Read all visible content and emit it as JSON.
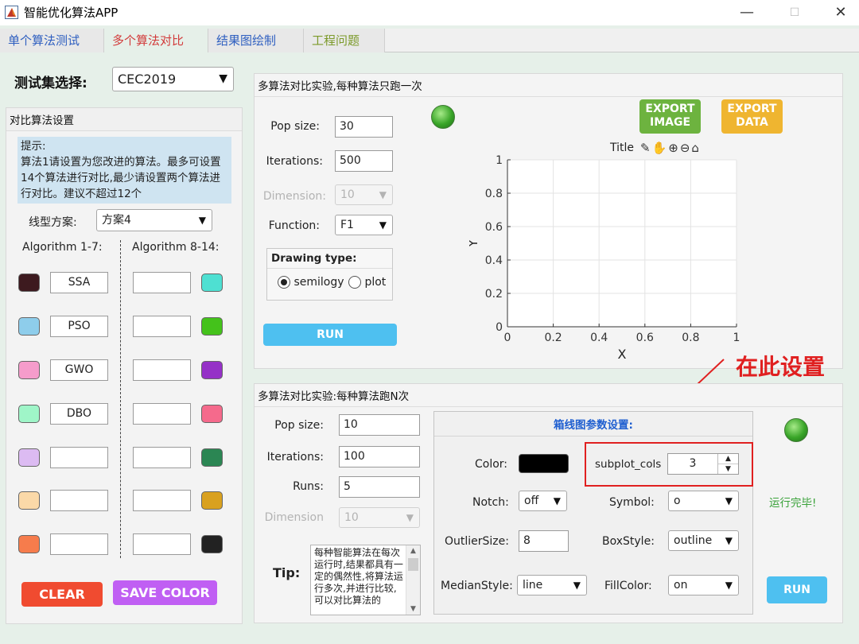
{
  "window": {
    "title": "智能优化算法APP",
    "minimize": "—",
    "maximize": "☐",
    "close": "✕"
  },
  "tabs": [
    {
      "label": "单个算法测试"
    },
    {
      "label": "多个算法对比"
    },
    {
      "label": "结果图绘制"
    },
    {
      "label": "工程问题"
    }
  ],
  "testset": {
    "label": "测试集选择:",
    "value": "CEC2019"
  },
  "compare": {
    "title": "对比算法设置",
    "hint": "提示:\n算法1请设置为您改进的算法。最多可设置14个算法进行对比,最少请设置两个算法进行对比。建议不超过12个",
    "line_scheme": {
      "label": "线型方案:",
      "value": "方案4"
    },
    "col1_header": "Algorithm 1-7:",
    "col2_header": "Algorithm 8-14:",
    "algos_left": [
      {
        "name": "SSA",
        "color": "#3d1a1f"
      },
      {
        "name": "PSO",
        "color": "#8ecdeb"
      },
      {
        "name": "GWO",
        "color": "#f59ccb"
      },
      {
        "name": "DBO",
        "color": "#9ff5c8"
      },
      {
        "name": "",
        "color": "#dcbbf2"
      },
      {
        "name": "",
        "color": "#fbd9a8"
      },
      {
        "name": "",
        "color": "#f67c4c"
      }
    ],
    "algos_right": [
      {
        "name": "",
        "color": "#4ee0d2"
      },
      {
        "name": "",
        "color": "#44c21b"
      },
      {
        "name": "",
        "color": "#9531c7"
      },
      {
        "name": "",
        "color": "#f56a8c"
      },
      {
        "name": "",
        "color": "#2b8653"
      },
      {
        "name": "",
        "color": "#d9a11f"
      },
      {
        "name": "",
        "color": "#222222"
      }
    ],
    "clear": "CLEAR",
    "save_color": "SAVE COLOR"
  },
  "once": {
    "title": "多算法对比实验,每种算法只跑一次",
    "pop_label": "Pop size:",
    "pop_value": "30",
    "iter_label": "Iterations:",
    "iter_value": "500",
    "dim_label": "Dimension:",
    "dim_value": "10",
    "func_label": "Function:",
    "func_value": "F1",
    "drawing_title": "Drawing type:",
    "semilogy": "semilogy",
    "plot": "plot",
    "run": "RUN",
    "export_image": "EXPORT\nIMAGE",
    "export_data": "EXPORT\nDATA"
  },
  "chart_data": {
    "type": "line",
    "title": "Title",
    "xlabel": "X",
    "ylabel": "Y",
    "xlim": [
      0,
      1
    ],
    "ylim": [
      0,
      1
    ],
    "xticks": [
      "0",
      "0.2",
      "0.4",
      "0.6",
      "0.8",
      "1"
    ],
    "yticks": [
      "0",
      "0.2",
      "0.4",
      "0.6",
      "0.8",
      "1"
    ],
    "grid": true,
    "series": []
  },
  "annotation": {
    "text": "在此设置",
    "color": "#e02020"
  },
  "ntimes": {
    "title": "多算法对比实验:每种算法跑N次",
    "pop_label": "Pop size:",
    "pop_value": "10",
    "iter_label": "Iterations:",
    "iter_value": "100",
    "runs_label": "Runs:",
    "runs_value": "5",
    "dim_label": "Dimension",
    "dim_value": "10",
    "tip_label": "Tip:",
    "tip_text": "每种智能算法在每次运行时,结果都具有一定的偶然性,将算法运行多次,并进行比较,可以对比算法的",
    "boxplot": {
      "title": "箱线图参数设置:",
      "color_label": "Color:",
      "subplot_label": "subplot_cols",
      "subplot_value": "3",
      "notch_label": "Notch:",
      "notch_value": "off",
      "symbol_label": "Symbol:",
      "symbol_value": "o",
      "outlier_label": "OutlierSize:",
      "outlier_value": "8",
      "boxstyle_label": "BoxStyle:",
      "boxstyle_value": "outline",
      "median_label": "MedianStyle:",
      "median_value": "line",
      "fill_label": "FillColor:",
      "fill_value": "on"
    },
    "status": "运行完毕!",
    "run": "RUN"
  }
}
